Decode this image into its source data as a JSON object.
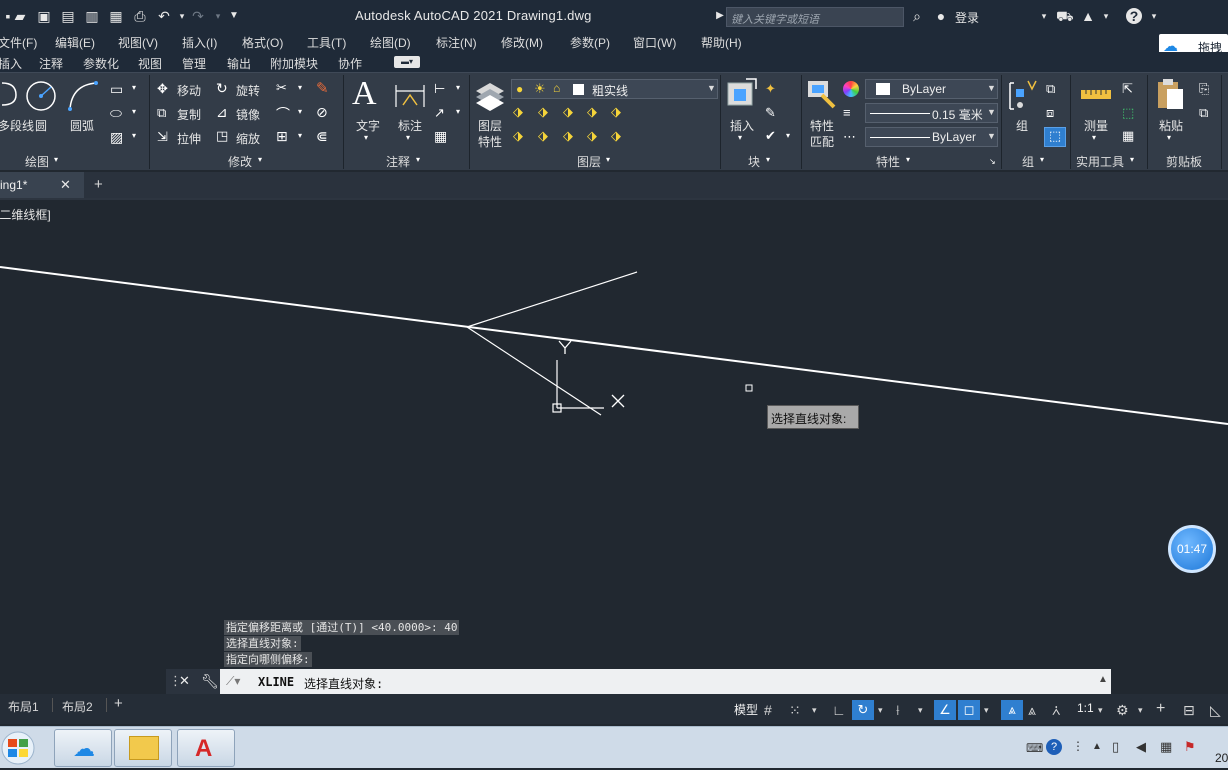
{
  "title_bar": {
    "app_title": "Autodesk AutoCAD 2021    Drawing1.dwg",
    "search_placeholder": "键入关键字或短语",
    "login_label": "登录",
    "cloud_label": "拖拽_"
  },
  "menu": [
    "文件(F)",
    "编辑(E)",
    "视图(V)",
    "插入(I)",
    "格式(O)",
    "工具(T)",
    "绘图(D)",
    "标注(N)",
    "修改(M)",
    "参数(P)",
    "窗口(W)",
    "帮助(H)"
  ],
  "ribbon_tabs": [
    "插入",
    "注释",
    "参数化",
    "视图",
    "管理",
    "输出",
    "附加模块",
    "协作"
  ],
  "ribbon": {
    "draw": {
      "title": "绘图",
      "polyline": "多段线",
      "circle": "圆",
      "arc": "圆弧"
    },
    "modify": {
      "title": "修改",
      "move": "移动",
      "rotate": "旋转",
      "copy": "复制",
      "mirror": "镜像",
      "stretch": "拉伸",
      "scale": "缩放"
    },
    "annotation": {
      "title": "注释",
      "text": "文字",
      "dimension": "标注"
    },
    "layers": {
      "title": "图层",
      "layer_props_1": "图层",
      "layer_props_2": "特性",
      "current_layer": "粗实线"
    },
    "block": {
      "title": "块",
      "insert": "插入"
    },
    "properties": {
      "title": "特性",
      "match_1": "特性",
      "match_2": "匹配",
      "color": "ByLayer",
      "lineweight": "0.15 毫米",
      "linetype": "ByLayer"
    },
    "groups": {
      "title": "组",
      "group": "组"
    },
    "utilities": {
      "title": "实用工具",
      "measure": "测量"
    },
    "clipboard": {
      "title": "剪贴板",
      "paste": "粘贴"
    }
  },
  "doc_tab": {
    "name": "ing1*"
  },
  "viewport": {
    "label": "[二维线框]",
    "tooltip": "选择直线对象:",
    "axis_y": "Y",
    "axis_x": "X",
    "timer": "01:47"
  },
  "command_history": [
    "指定偏移距离或 [通过(T)] <40.0000>: 40",
    "选择直线对象:",
    "指定向哪侧偏移:"
  ],
  "command_line": {
    "command": "XLINE",
    "prompt": "选择直线对象:"
  },
  "layout_tabs": [
    "布局1",
    "布局2"
  ],
  "status": {
    "model": "模型",
    "scale": "1:1"
  },
  "taskbar": {
    "clock": "20"
  },
  "colors": {
    "ribbon_bg": "#333c48",
    "canvas_bg": "#212830",
    "title_bg": "#1f2a38",
    "accent": "#1e88e5"
  }
}
